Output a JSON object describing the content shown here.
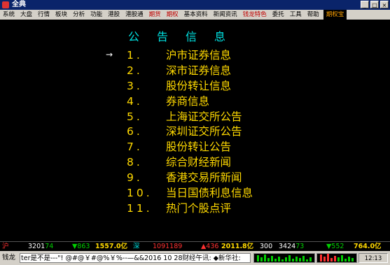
{
  "window": {
    "title": "全典",
    "controls": [
      "_",
      "□",
      "×"
    ]
  },
  "menu": [
    {
      "label": "系统",
      "color": "normal"
    },
    {
      "label": "大盘",
      "color": "normal"
    },
    {
      "label": "行情",
      "color": "normal"
    },
    {
      "label": "板块",
      "color": "normal"
    },
    {
      "label": "分析",
      "color": "normal"
    },
    {
      "label": "功能",
      "color": "normal"
    },
    {
      "label": "港股",
      "color": "normal"
    },
    {
      "label": "港股通",
      "color": "normal"
    },
    {
      "label": "期货",
      "color": "red"
    },
    {
      "label": "期权",
      "color": "red"
    },
    {
      "label": "基本资料",
      "color": "normal"
    },
    {
      "label": "新闻资讯",
      "color": "normal"
    },
    {
      "label": "钱龙特色",
      "color": "red"
    },
    {
      "label": "委托",
      "color": "normal"
    },
    {
      "label": "工具",
      "color": "normal"
    },
    {
      "label": "帮助",
      "color": "normal"
    },
    {
      "label": "期权宝",
      "color": "boxed"
    }
  ],
  "heading": "公告信息",
  "selection_marker": "→",
  "items": [
    {
      "num": "1.",
      "label": "沪市证券信息"
    },
    {
      "num": "2.",
      "label": "深市证券信息"
    },
    {
      "num": "3.",
      "label": "股份转让信息"
    },
    {
      "num": "4.",
      "label": "券商信息"
    },
    {
      "num": "5.",
      "label": "上海证交所公告"
    },
    {
      "num": "6.",
      "label": "深圳证交所公告"
    },
    {
      "num": "7.",
      "label": "股份转让公告"
    },
    {
      "num": "8.",
      "label": "综合财经新闻"
    },
    {
      "num": "9.",
      "label": "香港交易所新闻"
    },
    {
      "num": "10.",
      "label": "当日国债利息信息"
    },
    {
      "num": "11.",
      "label": "热门个股点评"
    }
  ],
  "status": {
    "sh_label": "沪",
    "sh_index": "3201",
    "sh_index_tail": "74",
    "sh_change": "▼863",
    "sh_amount": "1557.0亿",
    "sz_label": "深",
    "sz_index": "10911",
    "sz_index_tail": "89",
    "sz_change": "▲436",
    "sz_amount": "2011.8亿",
    "c300_label": "300",
    "c300_index": "3424",
    "c300_index_tail": "73",
    "c300_change": "▼552",
    "c300_amount": "764.0亿"
  },
  "ticker": {
    "label": "钱龙",
    "text": "ter是不是---\"! @#@￥#@%￥%--—&&2016 10 28财经午讯: ◆新华社:",
    "time": "12:13"
  },
  "colors": {
    "heading": "#00e0e0",
    "items": "#ffd900",
    "up": "#ff3030",
    "down": "#00d000"
  }
}
